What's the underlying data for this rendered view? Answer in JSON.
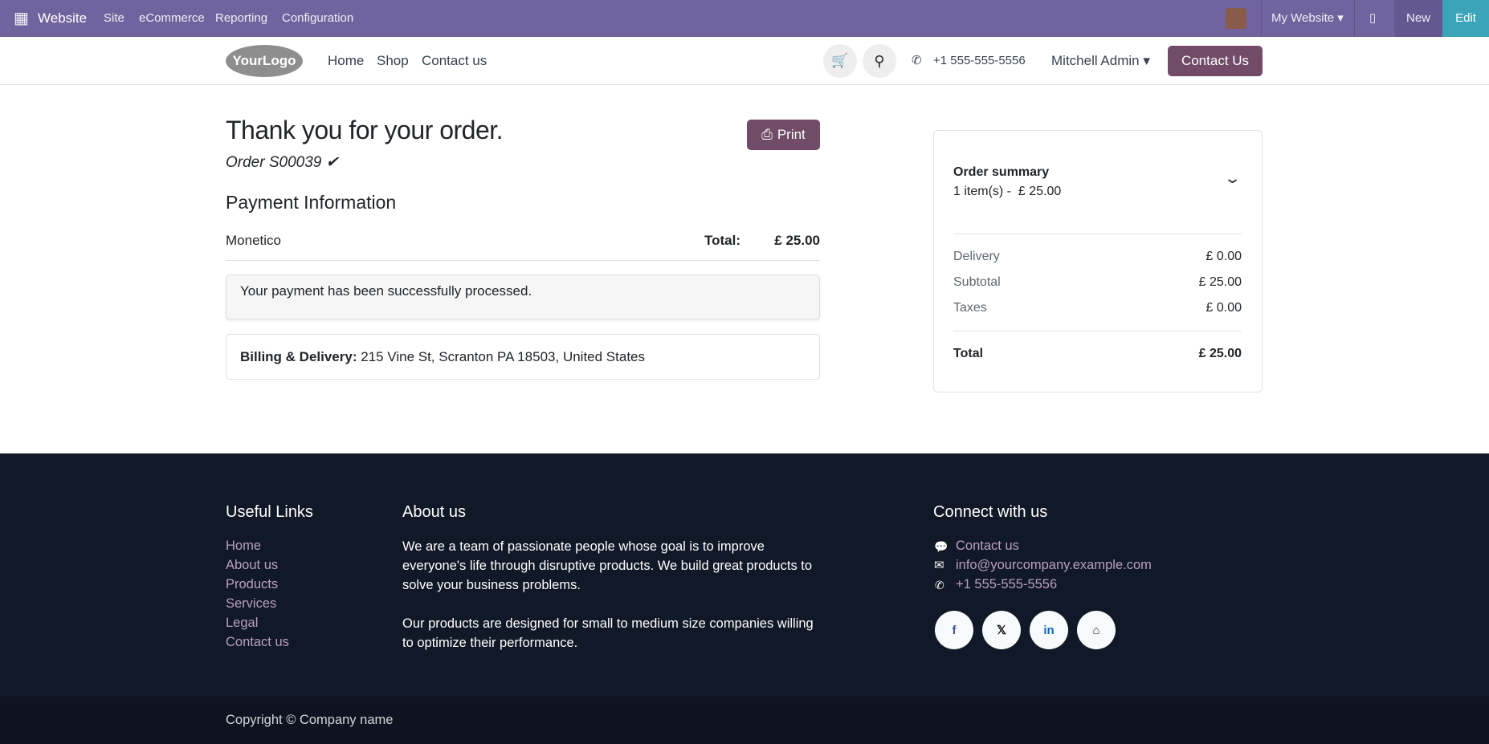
{
  "topbar": {
    "app": "Website",
    "menu": [
      "Site",
      "eCommerce",
      "Reporting",
      "Configuration"
    ],
    "website_selector": "My Website",
    "new": "New",
    "edit": "Edit"
  },
  "header": {
    "logo": "YourLogo",
    "nav": [
      "Home",
      "Shop",
      "Contact us"
    ],
    "phone": "+1 555-555-5556",
    "user": "Mitchell Admin",
    "cta": "Contact Us"
  },
  "main": {
    "title": "Thank you for your order.",
    "order": "Order S00039",
    "print": "Print",
    "payment_heading": "Payment Information",
    "provider": "Monetico",
    "total_label": "Total:",
    "total_value": "£ 25.00",
    "alert": "Your payment has been successfully processed.",
    "billing_label": "Billing & Delivery:",
    "billing_address": "215 Vine St, Scranton PA 18503, United States"
  },
  "summary": {
    "title": "Order summary",
    "items": "1 item(s) -  £ 25.00",
    "rows": [
      {
        "label": "Delivery",
        "value": "£ 0.00"
      },
      {
        "label": "Subtotal",
        "value": "£ 25.00"
      },
      {
        "label": "Taxes",
        "value": "£ 0.00"
      }
    ],
    "total_label": "Total",
    "total_value": "£ 25.00"
  },
  "footer": {
    "useful_heading": "Useful Links",
    "links": [
      "Home",
      "About us",
      "Products",
      "Services",
      "Legal",
      "Contact us"
    ],
    "about_heading": "About us",
    "about_p1": "We are a team of passionate people whose goal is to improve everyone's life through disruptive products. We build great products to solve your business problems.",
    "about_p2": "Our products are designed for small to medium size companies willing to optimize their performance.",
    "connect_heading": "Connect with us",
    "contact": "Contact us",
    "email": "info@yourcompany.example.com",
    "phone": "+1 555-555-5556",
    "copyright": "Copyright © Company name"
  }
}
